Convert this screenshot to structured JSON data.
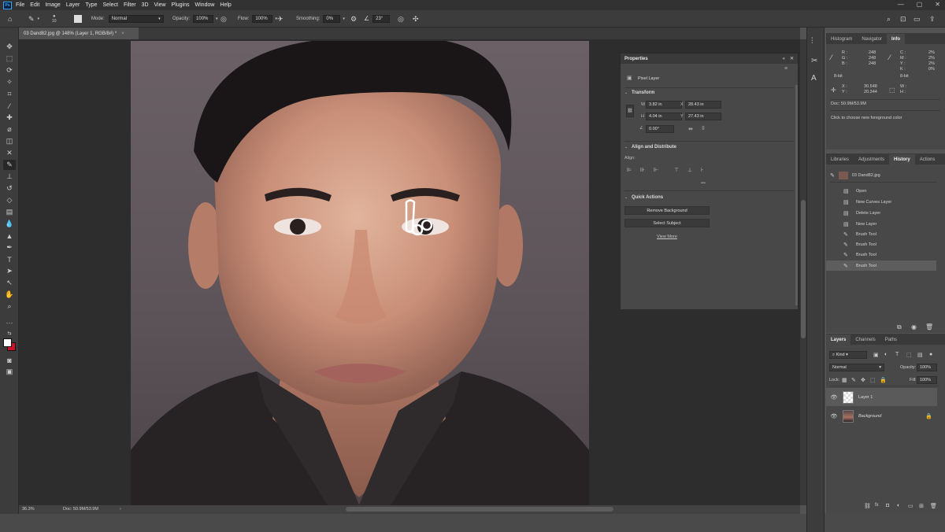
{
  "menu": [
    "File",
    "Edit",
    "Image",
    "Layer",
    "Type",
    "Select",
    "Filter",
    "3D",
    "View",
    "Plugins",
    "Window",
    "Help"
  ],
  "app_logo": "Ps",
  "options": {
    "brush_size": "10",
    "mode_label": "Mode:",
    "mode_value": "Normal",
    "opacity_label": "Opacity:",
    "opacity_value": "100%",
    "flow_label": "Flow:",
    "flow_value": "100%",
    "smoothing_label": "Smoothing:",
    "smoothing_value": "0%",
    "angle_value": "23°"
  },
  "doc_tab": {
    "title": "03 Dand82.jpg @ 148% (Layer 1, RGB/8#) *",
    "close": "×"
  },
  "properties": {
    "title": "Properties",
    "pixel_layer": "Pixel Layer",
    "transform_title": "Transform",
    "w_label": "W",
    "w_value": "3.82 in",
    "h_label": "H",
    "h_value": "4.04 in",
    "x_label": "X",
    "x_value": "28.43 in",
    "y_label": "Y",
    "y_value": "27.43 in",
    "angle_value": "0.00°",
    "align_title": "Align and Distribute",
    "align_label": "Align:",
    "more": "•••",
    "quick_title": "Quick Actions",
    "remove_bg": "Remove Background",
    "select_subject": "Select Subject",
    "view_more": "View More"
  },
  "info_panel": {
    "tabs": [
      "Histogram",
      "Navigator",
      "Info"
    ],
    "active_tab": "Info",
    "r_label": "R :",
    "r_value": "248",
    "g_label": "G :",
    "g_value": "248",
    "b_label": "B :",
    "b_value": "248",
    "c_label": "C :",
    "c_value": "2%",
    "m_label": "M :",
    "m_value": "2%",
    "y_label": "Y :",
    "y_value": "2%",
    "k_label": "K :",
    "k_value": "0%",
    "bit_left": "8-bit",
    "bit_right": "8-bit",
    "x_label": "X :",
    "x_value": "30.548",
    "y2_label": "Y :",
    "y2_value": "20.344",
    "w_label": "W :",
    "h_label": "H :",
    "doc_size": "Doc: 50.9M/53.9M",
    "hint": "Click to choose new foreground color"
  },
  "history_panel": {
    "tabs": [
      "Libraries",
      "Adjustments",
      "History",
      "Actions"
    ],
    "active_tab": "History",
    "snapshot": "03 Dand82.jpg",
    "items": [
      "Open",
      "New Curves Layer",
      "Delete Layer",
      "New Layer",
      "Brush Tool",
      "Brush Tool",
      "Brush Tool",
      "Brush Tool"
    ],
    "selected_index": 7
  },
  "layers_panel": {
    "tabs": [
      "Layers",
      "Channels",
      "Paths"
    ],
    "active_tab": "Layers",
    "kind": "Kind",
    "blend_mode": "Normal",
    "opacity_label": "Opacity:",
    "opacity_value": "100%",
    "lock_label": "Lock:",
    "fill_label": "Fill:",
    "fill_value": "100%",
    "layers": [
      "Layer 1",
      "Background"
    ]
  },
  "status": {
    "zoom": "36.3%",
    "doc": "Doc: 50.9M/53.9M"
  },
  "colors": {
    "foreground": "#ffffff",
    "background": "#d0102a",
    "accent": "#31a8ff"
  }
}
